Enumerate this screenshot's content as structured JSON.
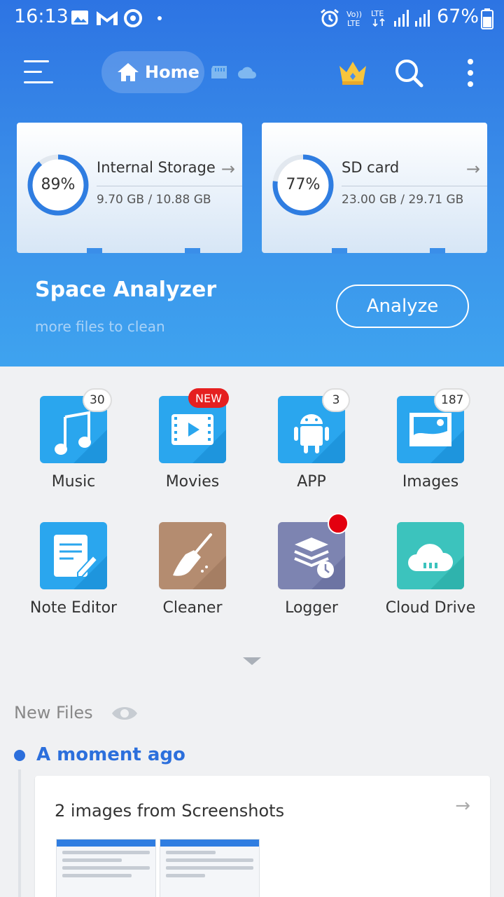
{
  "status_bar": {
    "time": "16:13",
    "battery_percent": "67%",
    "icons": [
      "gallery-icon",
      "gmail-icon",
      "sync-icon",
      "dot-icon",
      "alarm-icon",
      "volte-icon",
      "lte-icon",
      "signal-icon",
      "signal-icon",
      "battery-icon"
    ]
  },
  "app_bar": {
    "home_label": "Home",
    "icons": [
      "menu-icon",
      "home-icon",
      "sd-card-icon",
      "cloud-icon",
      "crown-icon",
      "search-icon",
      "more-icon"
    ]
  },
  "storage": [
    {
      "name": "Internal Storage",
      "percent_label": "89%",
      "percent": 0.89,
      "size": "9.70 GB / 10.88 GB"
    },
    {
      "name": "SD card",
      "percent_label": "77%",
      "percent": 0.77,
      "size": "23.00 GB / 29.71 GB"
    }
  ],
  "space_analyzer": {
    "title": "Space Analyzer",
    "subtitle": "more files to clean",
    "button": "Analyze"
  },
  "tools": [
    {
      "label": "Music",
      "badge": "30",
      "icon": "music-icon",
      "color": "#2aa6ee"
    },
    {
      "label": "Movies",
      "badge": "NEW",
      "icon": "movie-icon",
      "color": "#2aa6ee"
    },
    {
      "label": "APP",
      "badge": "3",
      "icon": "android-icon",
      "color": "#2aa6ee"
    },
    {
      "label": "Images",
      "badge": "187",
      "icon": "image-icon",
      "color": "#2aa6ee"
    },
    {
      "label": "Note Editor",
      "icon": "note-icon",
      "color": "#2aa6ee"
    },
    {
      "label": "Cleaner",
      "icon": "broom-icon",
      "color": "#b48c70"
    },
    {
      "label": "Logger",
      "icon": "logger-icon",
      "color": "#7d84b1"
    },
    {
      "label": "Cloud Drive",
      "icon": "cloud-drive-icon",
      "color": "#3cc3bd"
    }
  ],
  "new_files": {
    "title": "New Files",
    "time_label": "A moment ago",
    "card_title": "2 images from Screenshots"
  }
}
